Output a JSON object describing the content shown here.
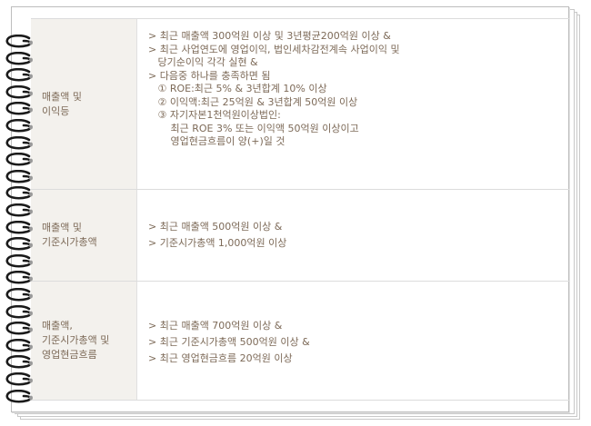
{
  "rows": [
    {
      "label": "매출액 및\n이익등",
      "lines": [
        "> 최근 매출액 300억원 이상 및 3년평균200억원 이상 &",
        "> 최근 사업연도에 영업이익, 법인세차감전계속 사업이익 및",
        "   당기순이익 각각 실현 &",
        "> 다음중 하나를 충족하면 됨",
        "   ① ROE:최근 5% & 3년합계 10% 이상",
        "   ② 이익액:최근 25억원 & 3년합계 50억원 이상",
        "   ③ 자기자본1천억원이상법인:",
        "       최근 ROE 3% 또는 이익액 50억원 이상이고",
        "       영업현금흐름이 양(+)일 것"
      ]
    },
    {
      "label": "매출액 및\n기준시가총액",
      "lines": [
        "> 최근 매출액 500억원 이상 &",
        "> 기준시가총액 1,000억원 이상"
      ]
    },
    {
      "label": "매출액,\n기준시가총액 및\n영업현금흐름",
      "lines": [
        "> 최근 매출액 700억원 이상 &",
        "> 최근 기준시가총액 500억원 이상 &",
        "> 최근 영업현금흐름 20억원 이상"
      ]
    }
  ],
  "decoration": {
    "binding_icon": "spiral-binding-rings"
  },
  "colors": {
    "text": "#7d6a58",
    "label_bg": "#f3f1ed",
    "border": "#dcdcdc"
  }
}
